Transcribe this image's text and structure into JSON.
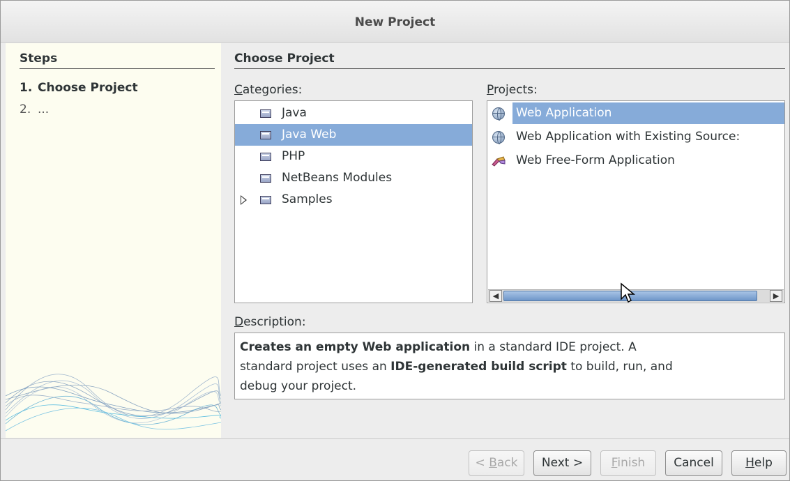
{
  "window": {
    "title": "New Project"
  },
  "steps": {
    "title": "Steps",
    "items": [
      {
        "num": "1.",
        "label": "Choose Project"
      },
      {
        "num": "2.",
        "label": "..."
      }
    ]
  },
  "main": {
    "title": "Choose Project",
    "categories_label_mnemonic": "C",
    "categories_label_rest": "ategories:",
    "projects_label_mnemonic": "P",
    "projects_label_rest": "rojects:",
    "description_label_mnemonic": "D",
    "description_label_rest": "escription:"
  },
  "categories": [
    {
      "label": "Java",
      "icon": "folder-icon",
      "selected": false
    },
    {
      "label": "Java Web",
      "icon": "folder-icon",
      "selected": true
    },
    {
      "label": "PHP",
      "icon": "folder-icon",
      "selected": false
    },
    {
      "label": "NetBeans Modules",
      "icon": "folder-icon",
      "selected": false
    },
    {
      "label": "Samples",
      "icon": "folder-icon",
      "selected": false,
      "expandable": true
    }
  ],
  "projects": [
    {
      "label": "Web Application",
      "icon": "globe-icon",
      "selected": true
    },
    {
      "label": "Web Application with Existing Source:",
      "icon": "globe-icon",
      "selected": false
    },
    {
      "label": "Web Free-Form Application",
      "icon": "brush-icon",
      "selected": false
    }
  ],
  "description": {
    "p1_bold": "Creates an empty Web application",
    "p1_rest": " in a standard IDE project. A",
    "p2_start": "standard project uses an ",
    "p2_bold": "IDE-generated build script",
    "p2_rest": " to build, run, and",
    "p3": "debug your project."
  },
  "buttons": {
    "back_prefix": "< ",
    "back_mnemonic": "B",
    "back_rest": "ack",
    "next": "Next >",
    "finish_mnemonic": "F",
    "finish_rest": "inish",
    "cancel": "Cancel",
    "help_mnemonic": "H",
    "help_rest": "elp"
  },
  "colors": {
    "selection": "#86abd9",
    "steps_background": "#fdfdf0",
    "dialog_background": "#ededed"
  }
}
